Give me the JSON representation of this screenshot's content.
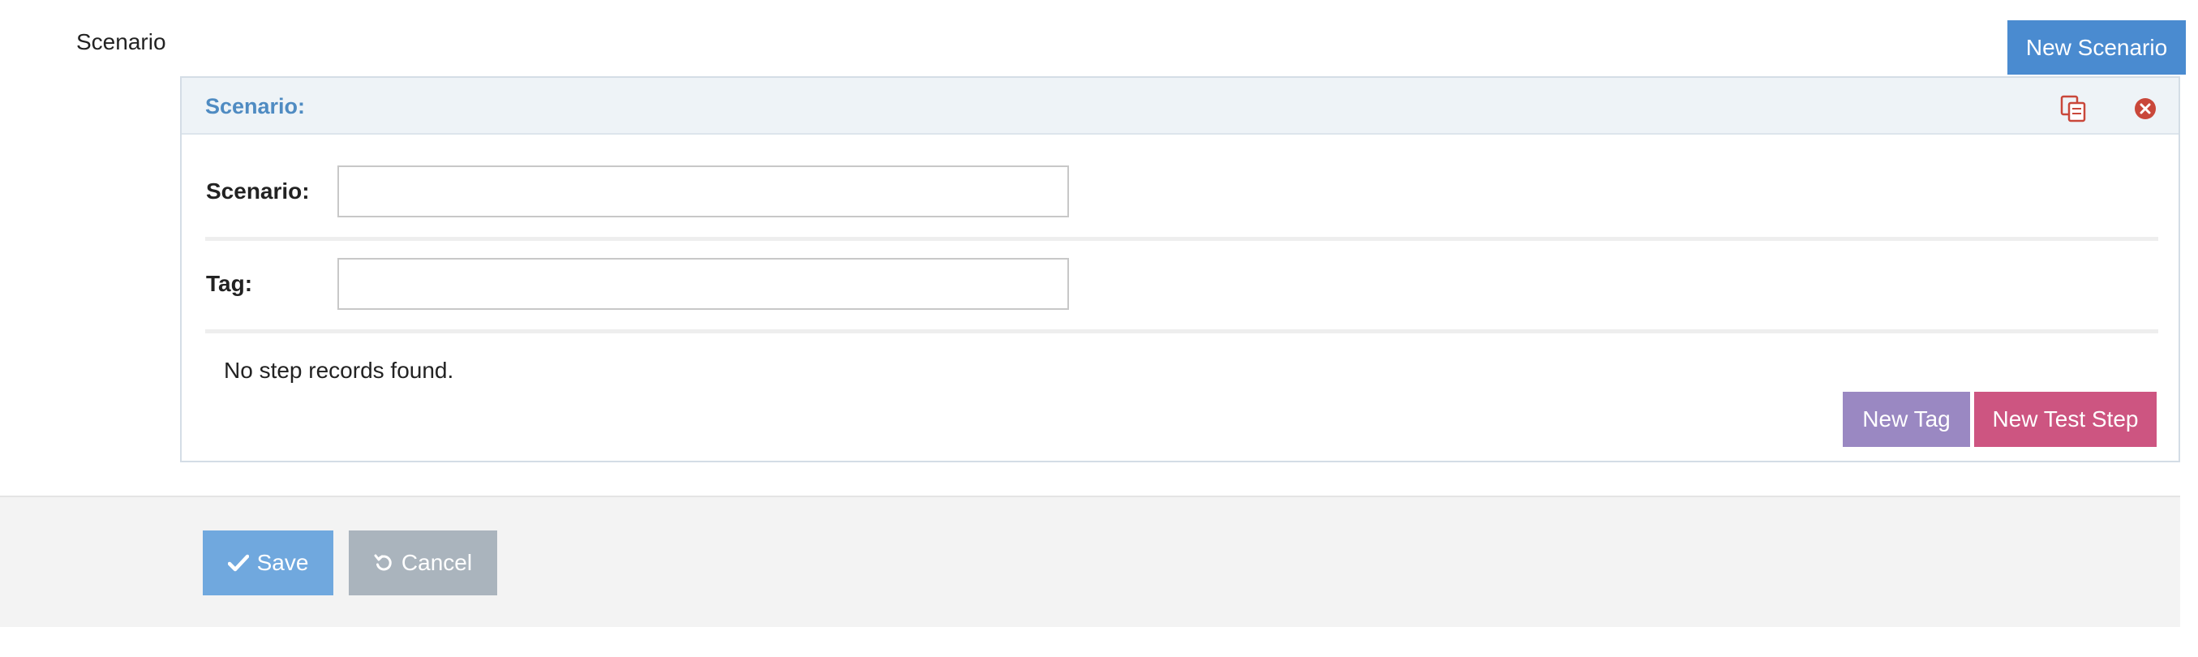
{
  "page": {
    "side_label": "Scenario",
    "new_scenario_button": "New Scenario"
  },
  "panel": {
    "title": "Scenario:",
    "copy_icon": "copy-icon",
    "close_icon": "close-circle-icon",
    "fields": {
      "scenario_label": "Scenario:",
      "scenario_value": "",
      "tag_label": "Tag:",
      "tag_value": ""
    },
    "empty_message": "No step records found.",
    "new_tag_button": "New Tag",
    "new_test_step_button": "New Test Step"
  },
  "footer": {
    "save_button": "Save",
    "save_icon": "check-icon",
    "cancel_button": "Cancel",
    "cancel_icon": "undo-icon"
  },
  "colors": {
    "primary": "#4a8bd0",
    "save": "#70a8de",
    "cancel": "#aab4bd",
    "new_tag": "#9a88c2",
    "new_test_step": "#cd5581",
    "panel_title": "#4f8bc2",
    "icon_red": "#c9473a"
  }
}
